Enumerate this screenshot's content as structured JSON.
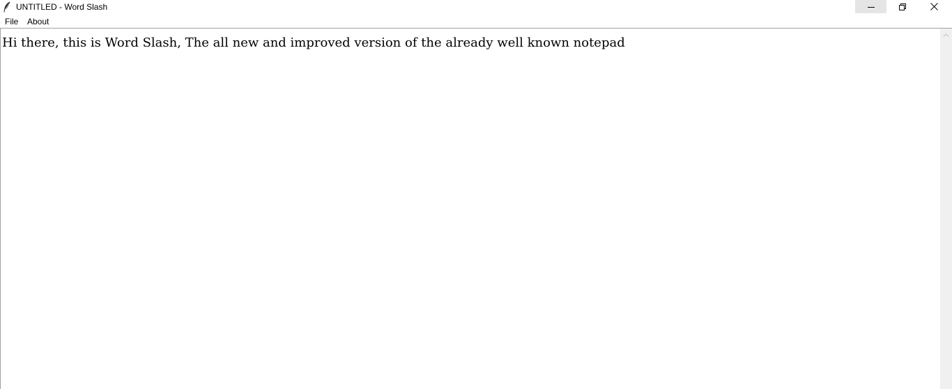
{
  "window": {
    "title": "UNTITLED - Word Slash",
    "icon": "feather-quill-icon",
    "controls": {
      "minimize_icon": "minimize-icon",
      "maximize_icon": "restore-icon",
      "close_icon": "close-icon"
    }
  },
  "menubar": {
    "items": [
      {
        "label": "File"
      },
      {
        "label": "About"
      }
    ]
  },
  "editor": {
    "content": "Hi there, this is Word Slash, The all new and improved version of the already well known notepad"
  },
  "scrollbar": {
    "up_icon": "scroll-up-arrow-icon"
  },
  "colors": {
    "minimize_hover_bg": "#e5e5e5",
    "scrollbar_bg": "#f0f0f0",
    "separator": "#a0a0a0"
  }
}
